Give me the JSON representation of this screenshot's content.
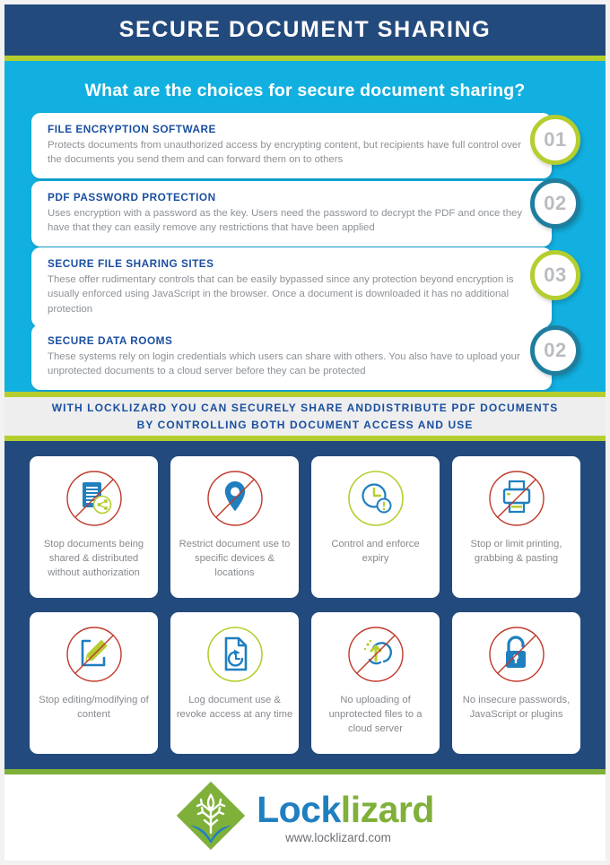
{
  "header": {
    "title": "SECURE DOCUMENT SHARING"
  },
  "choices_section": {
    "subtitle": "What are the choices for secure document sharing?",
    "items": [
      {
        "number": "01",
        "ring": "green",
        "title": "FILE ENCRYPTION SOFTWARE",
        "body": "Protects documents from unauthorized access by encrypting content, but recipients have full control over the documents you send them and can forward them on to others"
      },
      {
        "number": "02",
        "ring": "teal",
        "title": "PDF PASSWORD PROTECTION",
        "body": "Uses encryption with a password as the key. Users need the password to decrypt the PDF and once they have that they can easily remove any restrictions that have been applied"
      },
      {
        "number": "03",
        "ring": "green",
        "title": "SECURE FILE SHARING SITES",
        "body": "These offer rudimentary controls that can be easily bypassed since any protection beyond encryption is usually enforced using JavaScript in the browser. Once a document is downloaded it has no additional protection"
      },
      {
        "number": "02",
        "ring": "teal",
        "title": "SECURE DATA ROOMS",
        "body": "These systems rely on login credentials which users can share with others. You also have to upload your unprotected documents to a cloud server before they can be protected"
      }
    ]
  },
  "banner": {
    "line1": "WITH LOCKLIZARD YOU CAN SECURELY SHARE ANDDISTRIBUTE PDF DOCUMENTS",
    "line2": "BY CONTROLLING BOTH DOCUMENT ACCESS AND USE"
  },
  "features": [
    {
      "icon": "document-share-icon",
      "slashed": true,
      "ring": "red",
      "label": "Stop documents being shared & distributed without authorization"
    },
    {
      "icon": "location-pin-icon",
      "slashed": true,
      "ring": "red",
      "label": "Restrict document use to specific devices & locations"
    },
    {
      "icon": "clock-alert-icon",
      "slashed": false,
      "ring": "green",
      "label": "Control and enforce expiry"
    },
    {
      "icon": "printer-icon",
      "slashed": true,
      "ring": "red",
      "label": "Stop or limit printing, grabbing & pasting"
    },
    {
      "icon": "pencil-edit-icon",
      "slashed": true,
      "ring": "red",
      "label": "Stop editing/modifying of content"
    },
    {
      "icon": "document-revoke-icon",
      "slashed": false,
      "ring": "green",
      "label": "Log document use & revoke access at any time"
    },
    {
      "icon": "cloud-upload-icon",
      "slashed": true,
      "ring": "red",
      "label": "No uploading of unprotected files to a cloud server"
    },
    {
      "icon": "open-padlock-icon",
      "slashed": true,
      "ring": "red",
      "label": "No insecure passwords, JavaScript or plugins"
    }
  ],
  "footer": {
    "brand_lock": "Lock",
    "brand_lizard": "lizard",
    "url": "www.locklizard.com"
  },
  "colors": {
    "navy": "#234a7d",
    "cyan": "#12b0e0",
    "lime": "#b5ce2f",
    "teal": "#1f7e9e",
    "heading_blue": "#1a4fa0",
    "body_gray": "#8d9196",
    "red_slash": "#c0392b",
    "icon_blue": "#1f7fbf",
    "green": "#7fb03a"
  }
}
